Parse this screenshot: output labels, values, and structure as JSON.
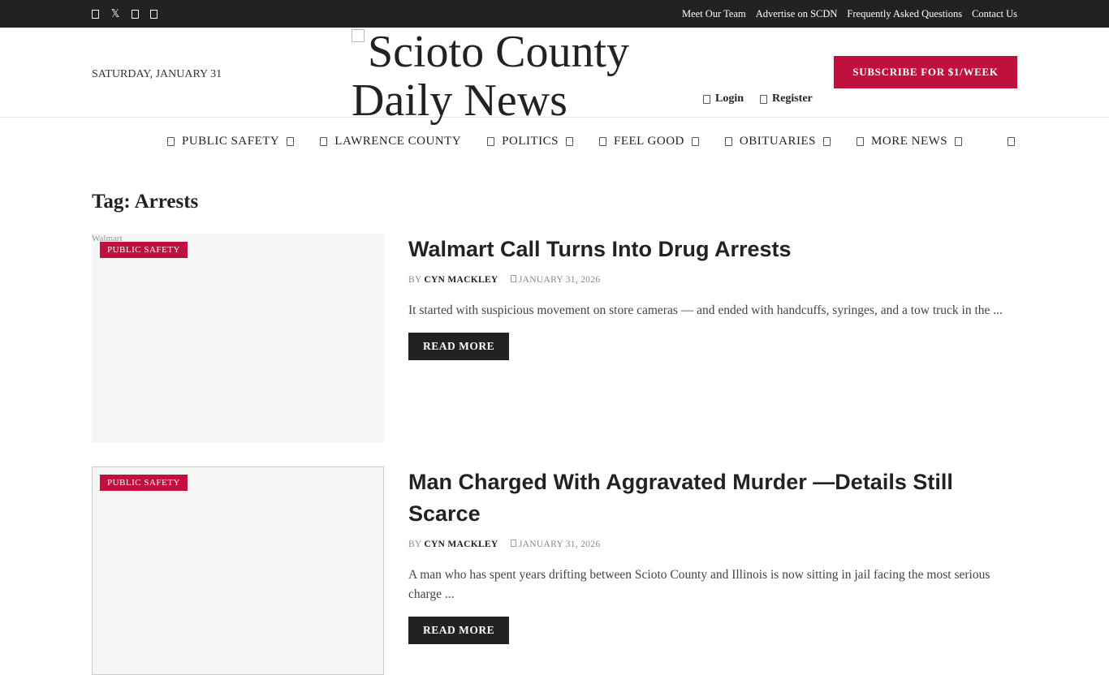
{
  "topbar": {
    "social_icons": [
      "facebook-icon",
      "x-twitter-icon",
      "instagram-icon",
      "youtube-icon"
    ],
    "links": [
      "Meet Our Team",
      "Advertise on SCDN",
      "Frequently Asked Questions",
      "Contact Us"
    ]
  },
  "header": {
    "date": "SATURDAY, JANUARY 31",
    "logo_alt": "Scioto County Daily News",
    "login": "Login",
    "register": "Register",
    "subscribe": "SUBSCRIBE FOR $1/WEEK"
  },
  "nav": {
    "items": [
      {
        "label": "PUBLIC SAFETY",
        "dropdown": true
      },
      {
        "label": "LAWRENCE COUNTY",
        "dropdown": false
      },
      {
        "label": "POLITICS",
        "dropdown": true
      },
      {
        "label": "FEEL GOOD",
        "dropdown": true
      },
      {
        "label": "OBITUARIES",
        "dropdown": true
      },
      {
        "label": "MORE NEWS",
        "dropdown": true
      }
    ]
  },
  "page": {
    "title": "Tag: Arrests"
  },
  "posts": [
    {
      "image_alt": "Walmart",
      "category": "PUBLIC SAFETY",
      "title": "Walmart Call Turns Into Drug Arrests",
      "by": "BY",
      "author": "CYN MACKLEY",
      "date": "JANUARY 31, 2026",
      "excerpt": "It started with suspicious movement on store cameras — and ended with handcuffs, syringes, and a tow truck in the ...",
      "read_more": "READ MORE"
    },
    {
      "image_alt": "",
      "category": "PUBLIC SAFETY",
      "title": "Man Charged With Aggravated Murder —Details Still Scarce",
      "by": "BY",
      "author": "CYN MACKLEY",
      "date": "JANUARY 31, 2026",
      "excerpt": "A man who has spent years drifting between Scioto County and Illinois is now sitting in jail facing the most serious charge ...",
      "read_more": "READ MORE"
    }
  ],
  "colors": {
    "brand": "#c0103e",
    "topbar": "#222222"
  }
}
